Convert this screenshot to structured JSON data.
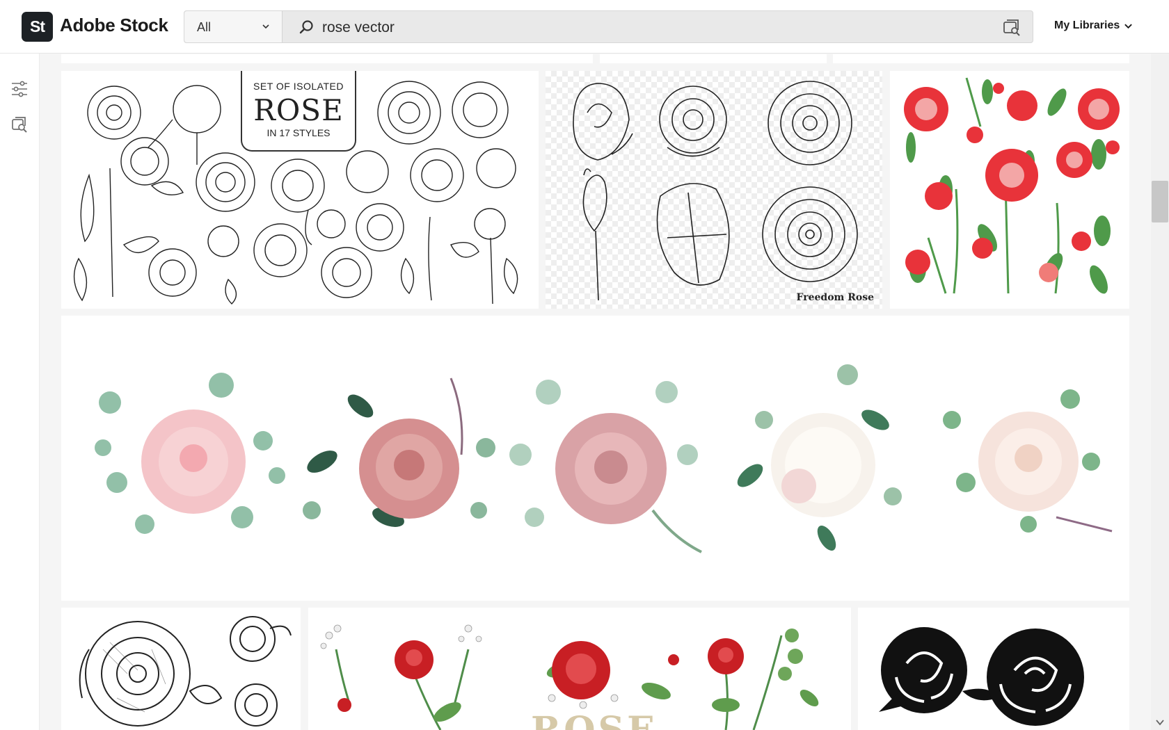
{
  "header": {
    "logo_text": "St",
    "brand": "Adobe Stock",
    "scope_selected": "All",
    "query": "rose vector",
    "my_libraries": "My Libraries"
  },
  "rail": {
    "icons": [
      "filters-icon",
      "visual-search-icon"
    ]
  },
  "results": {
    "tile_2_title": "SET OF ISOLATED",
    "tile_2_main": "ROSE",
    "tile_2_sub": "IN 17 STYLES",
    "tile_3_watermark": "Freedom Rose",
    "tile_9_text": "ROSE"
  },
  "colors": {
    "brand_dark": "#1d2125",
    "accent_red": "#e8333a",
    "leaf_green": "#4f9a4a",
    "blush": "#f1c2c5",
    "dusty_rose": "#c88988"
  }
}
